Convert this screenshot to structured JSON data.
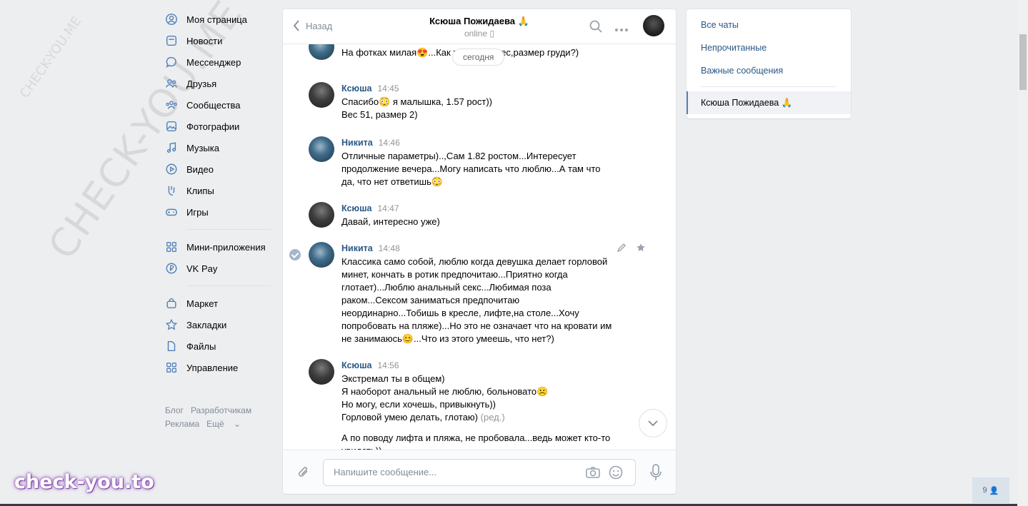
{
  "watermark": {
    "large": "CHECK-YOU.ME",
    "small": "CHECK-YOU.ME",
    "badge": "check-you.to"
  },
  "nav": {
    "items": [
      {
        "label": "Моя страница",
        "icon": "user-circle-icon"
      },
      {
        "label": "Новости",
        "icon": "news-icon"
      },
      {
        "label": "Мессенджер",
        "icon": "message-icon"
      },
      {
        "label": "Друзья",
        "icon": "friends-icon"
      },
      {
        "label": "Сообщества",
        "icon": "communities-icon"
      },
      {
        "label": "Фотографии",
        "icon": "photo-icon"
      },
      {
        "label": "Музыка",
        "icon": "music-icon"
      },
      {
        "label": "Видео",
        "icon": "video-icon"
      },
      {
        "label": "Клипы",
        "icon": "clips-icon"
      },
      {
        "label": "Игры",
        "icon": "gamepad-icon"
      }
    ],
    "items2": [
      {
        "label": "Мини-приложения",
        "icon": "apps-icon"
      },
      {
        "label": "VK Pay",
        "icon": "ruble-icon"
      }
    ],
    "items3": [
      {
        "label": "Маркет",
        "icon": "bag-icon"
      },
      {
        "label": "Закладки",
        "icon": "star-icon"
      },
      {
        "label": "Файлы",
        "icon": "file-icon"
      },
      {
        "label": "Управление",
        "icon": "apps-icon"
      }
    ],
    "footer": {
      "blog": "Блог",
      "devs": "Разработчикам",
      "ads": "Реклама",
      "more": "Ещё"
    }
  },
  "chat": {
    "back": "Назад",
    "peer_name": "Ксюша Пожидаева 🙏",
    "peer_status": "online",
    "date_pill": "сегодня",
    "messages": [
      {
        "author": "",
        "time": "",
        "text": "На фотках милая😍...Как тебе рост,вес,размер груди?)"
      },
      {
        "author": "Ксюша",
        "time": "14:45",
        "text": "Спасибо😳 я малышка, 1.57 рост))\nВес 51, размер 2)"
      },
      {
        "author": "Никита",
        "time": "14:46",
        "text": "Отличные параметры)..,Сам 1.82 ростом...Интересует\nпродолжение вечера...Могу написать что люблю...А там что\nда, что нет ответишь😳"
      },
      {
        "author": "Ксюша",
        "time": "14:47",
        "text": "Давай, интересно уже)"
      },
      {
        "author": "Никита",
        "time": "14:48",
        "text": "Классика само собой, люблю когда девушка делает горловой\nминет, кончать в ротик предпочитаю...Приятно когда\nглотает)...Люблю анальный секс...Любимая поза\nраком...Сексом заниматься предпочитаю\nнеординарно...Тобишь в кресле, лифте,на столе...Хочу\nпопробовать на пляже)...Но это не означает что на кровати им\nне занимаюсь😊...Что из этого умеешь, что нет?)"
      },
      {
        "author": "Ксюша",
        "time": "14:56",
        "text": "Экстремал ты в общем)\nЯ наоборот анальный не люблю, больновато☹️\nНо могу, если хочешь, привыкнуть))\nГорловой умею делать, глотаю)",
        "edited": "(ред.)",
        "text2": "А по поводу лифта и пляжа, не пробовала...ведь может кто-то\nувидеть))"
      }
    ],
    "compose_placeholder": "Напишите сообщение..."
  },
  "right_panel": {
    "all_chats": "Все чаты",
    "unread": "Непрочитанные",
    "important": "Важные сообщения",
    "active_chat": "Ксюша Пожидаева 🙏"
  },
  "online_count": "9",
  "colors": {
    "link": "#2a5885",
    "background": "#edeef0",
    "accent": "#5181b8"
  }
}
